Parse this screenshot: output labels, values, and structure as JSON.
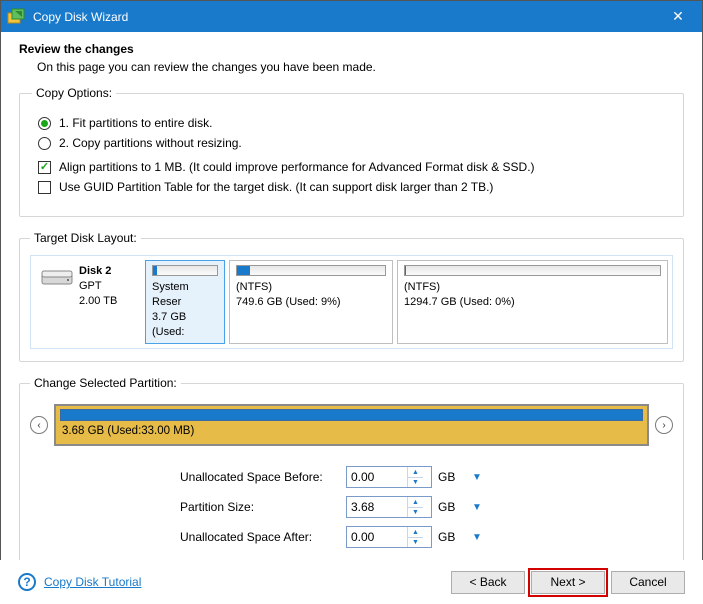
{
  "titlebar": {
    "title": "Copy Disk Wizard"
  },
  "header": {
    "title": "Review the changes",
    "subtitle": "On this page you can review the changes you have been made."
  },
  "copy_options": {
    "legend": "Copy Options:",
    "opt1": "1. Fit partitions to entire disk.",
    "opt2": "2. Copy partitions without resizing.",
    "align": "Align partitions to 1 MB.  (It could improve performance for Advanced Format disk & SSD.)",
    "guid": "Use GUID Partition Table for the target disk. (It can support disk larger than 2 TB.)"
  },
  "layout": {
    "legend": "Target Disk Layout:",
    "disk": {
      "name": "Disk 2",
      "type": "GPT",
      "size": "2.00 TB"
    },
    "p1": {
      "name": "System Reser",
      "info": "3.7 GB (Used:"
    },
    "p2": {
      "name": "(NTFS)",
      "info": "749.6 GB (Used: 9%)"
    },
    "p3": {
      "name": "(NTFS)",
      "info": "1294.7 GB (Used: 0%)"
    }
  },
  "selected": {
    "legend": "Change Selected Partition:",
    "bar_label": "3.68 GB (Used:33.00 MB)"
  },
  "form": {
    "before_label": "Unallocated Space Before:",
    "before_value": "0.00",
    "size_label": "Partition Size:",
    "size_value": "3.68",
    "after_label": "Unallocated Space After:",
    "after_value": "0.00",
    "unit": "GB"
  },
  "footer": {
    "tutorial": "Copy Disk Tutorial",
    "back": "< Back",
    "next": "Next >",
    "cancel": "Cancel"
  }
}
